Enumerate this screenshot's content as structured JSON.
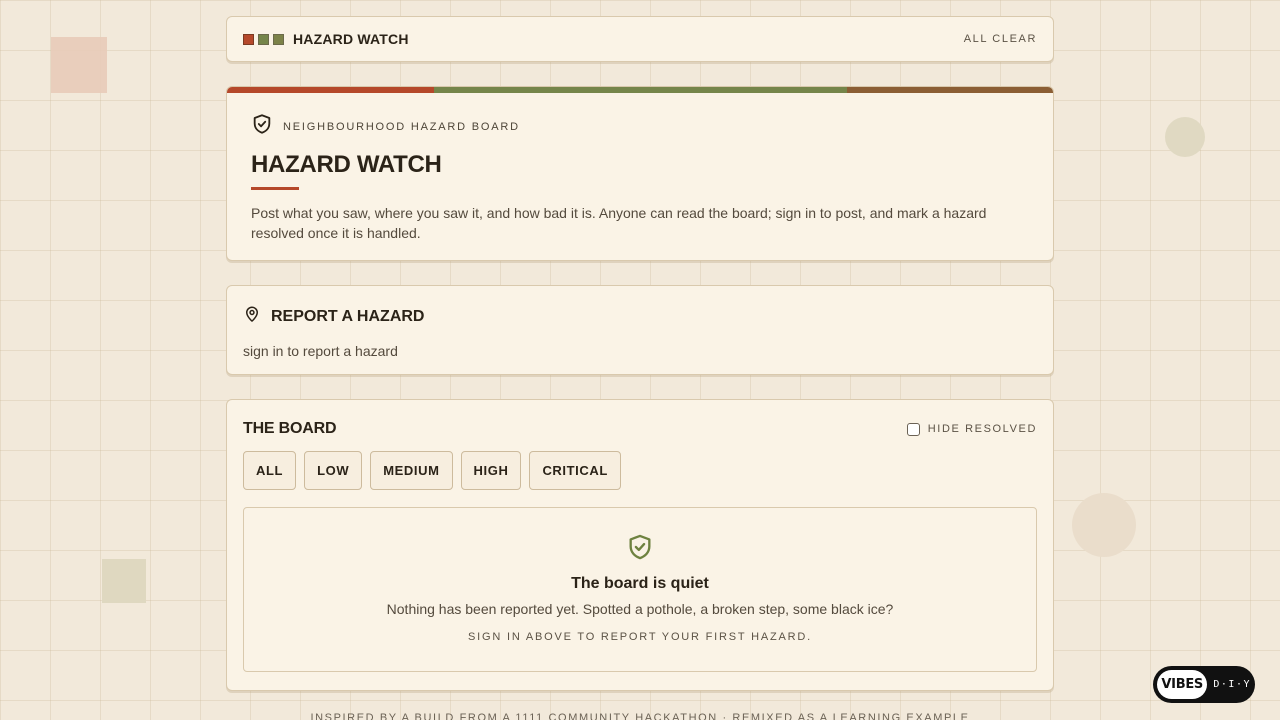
{
  "nav": {
    "brand": "HAZARD WATCH",
    "status": "ALL CLEAR"
  },
  "hero": {
    "eyebrow": "NEIGHBOURHOOD HAZARD BOARD",
    "title": "HAZARD WATCH",
    "description": "Post what you saw, where you saw it, and how bad it is. Anyone can read the board; sign in to post, and mark a hazard resolved once it is handled.",
    "accent_colors": [
      "#b5482a",
      "#75854a",
      "#8b5e34"
    ]
  },
  "report": {
    "title": "REPORT A HAZARD",
    "note": "sign in to report a hazard"
  },
  "board": {
    "title": "THE BOARD",
    "hide_resolved_label": "HIDE RESOLVED",
    "hide_resolved_checked": false,
    "filters": [
      "ALL",
      "LOW",
      "MEDIUM",
      "HIGH",
      "CRITICAL"
    ],
    "empty": {
      "title": "The board is quiet",
      "message": "Nothing has been reported yet. Spotted a pothole, a broken step, some black ice?",
      "cta": "SIGN IN ABOVE TO REPORT YOUR FIRST HAZARD."
    }
  },
  "footer": {
    "text": "INSPIRED BY A BUILD FROM A 1111 COMMUNITY HACKATHON · REMIXED AS A LEARNING EXAMPLE"
  },
  "badge": {
    "label": "VIBES",
    "suffix": "D·I·Y"
  },
  "icons": {
    "hero": "shield-check-icon",
    "report": "map-pin-icon",
    "empty": "shield-check-icon"
  }
}
